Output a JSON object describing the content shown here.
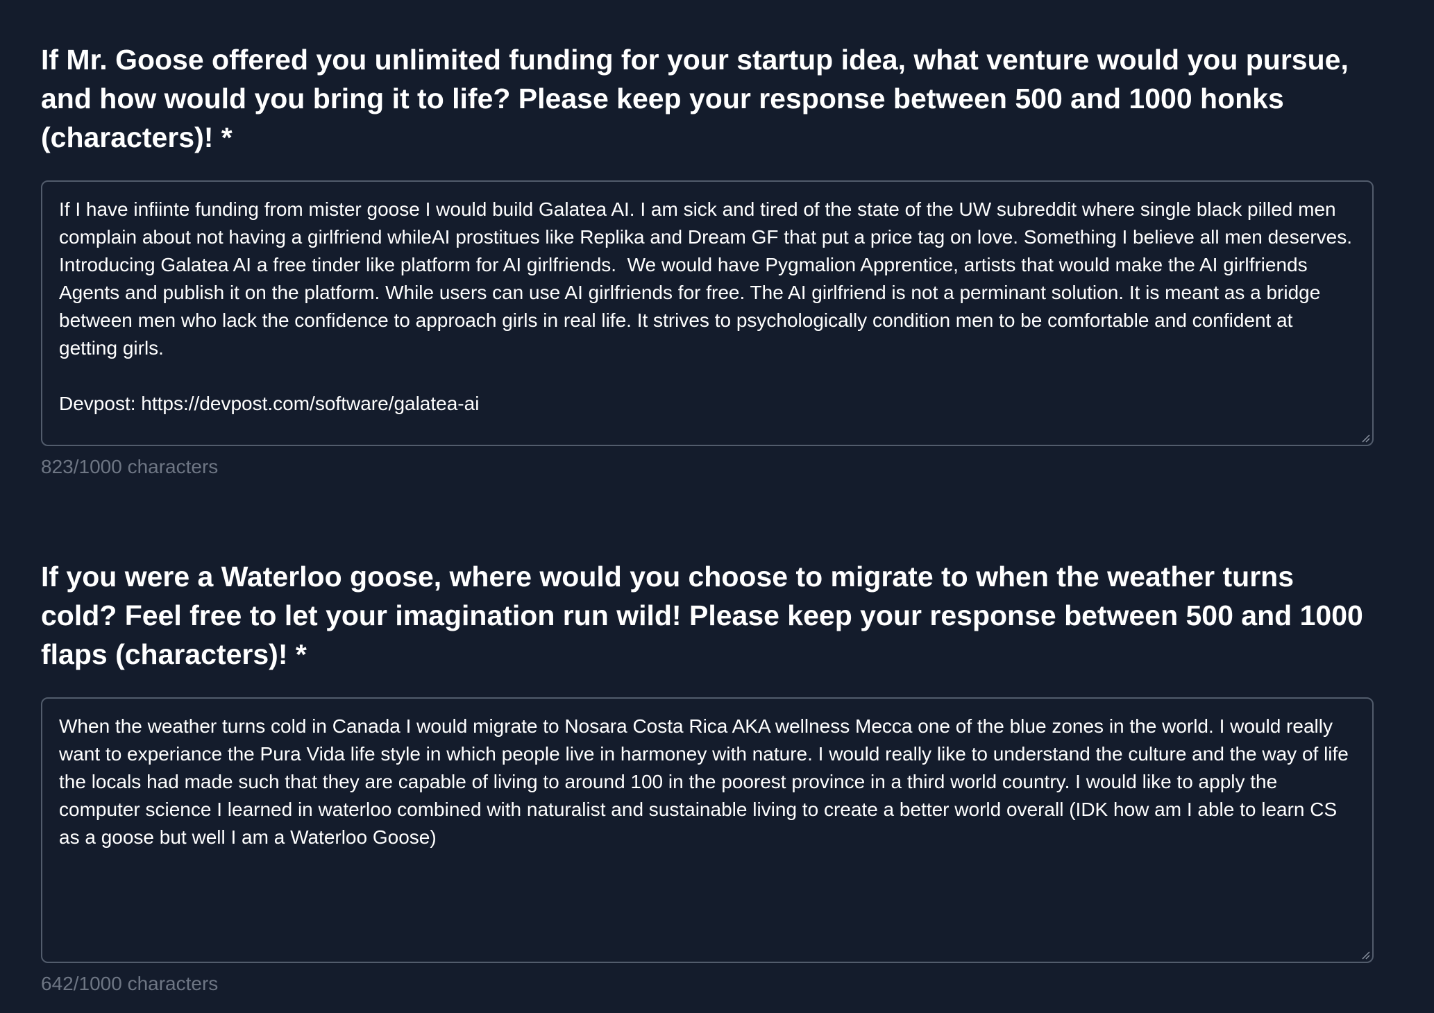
{
  "questions": [
    {
      "title": "If Mr. Goose offered you unlimited funding for your startup idea, what venture would you pursue, and how would you bring it to life? Please keep your response between 500 and 1000 honks (characters)! *",
      "answer": "If I have infiinte funding from mister goose I would build Galatea AI. I am sick and tired of the state of the UW subreddit where single black pilled men complain about not having a girlfriend whileAI prostitues like Replika and Dream GF that put a price tag on love. Something I believe all men deserves. Introducing Galatea AI a free tinder like platform for AI girlfriends.  We would have Pygmalion Apprentice, artists that would make the AI girlfriends Agents and publish it on the platform. While users can use AI girlfriends for free. The AI girlfriend is not a perminant solution. It is meant as a bridge between men who lack the confidence to approach girls in real life. It strives to psychologically condition men to be comfortable and confident at getting girls.\n\nDevpost: https://devpost.com/software/galatea-ai",
      "char_count": "823/1000 characters"
    },
    {
      "title": "If you were a Waterloo goose, where would you choose to migrate to when the weather turns cold? Feel free to let your imagination run wild! Please keep your response between 500 and 1000 flaps (characters)! *",
      "answer": "When the weather turns cold in Canada I would migrate to Nosara Costa Rica AKA wellness Mecca one of the blue zones in the world. I would really want to experiance the Pura Vida life style in which people live in harmoney with nature. I would really like to understand the culture and the way of life the locals had made such that they are capable of living to around 100 in the poorest province in a third world country. I would like to apply the computer science I learned in waterloo combined with naturalist and sustainable living to create a better world overall (IDK how am I able to learn CS as a goose but well I am a Waterloo Goose)",
      "char_count": "642/1000 characters"
    }
  ],
  "colors": {
    "background": "#141c2c",
    "border": "#525c6c",
    "muted_text": "#6e7684",
    "text": "#ffffff"
  },
  "icons": {
    "resize": "resize-grip-icon"
  }
}
